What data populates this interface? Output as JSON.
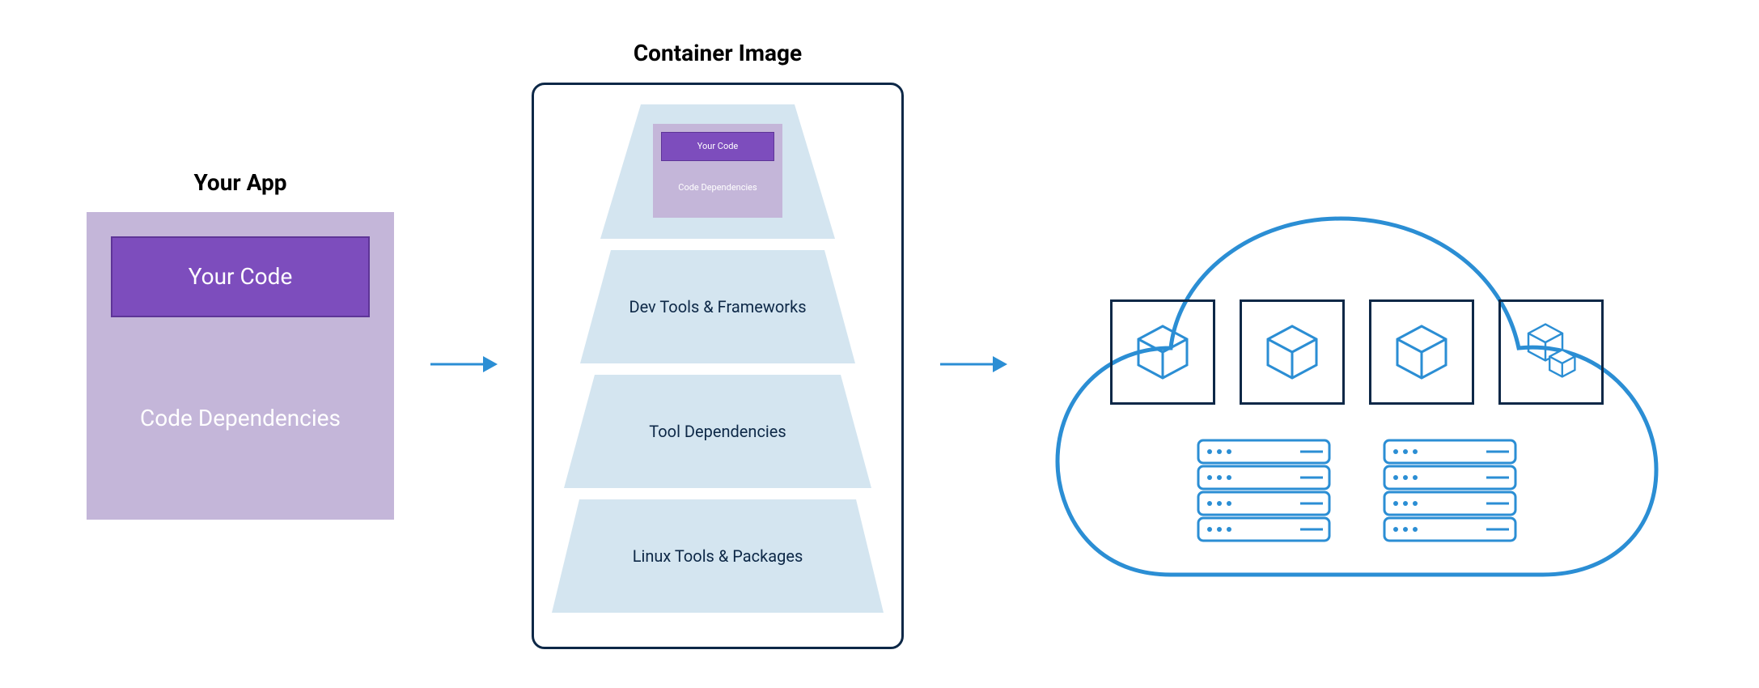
{
  "sections": {
    "app": {
      "title": "Your App",
      "code_label": "Your Code",
      "deps_label": "Code Dependencies"
    },
    "container": {
      "title": "Container Image",
      "mini_code_label": "Your Code",
      "mini_deps_label": "Code Dependencies",
      "layers": [
        "",
        "Dev Tools & Frameworks",
        "Tool Dependencies",
        "Linux Tools & Packages"
      ]
    },
    "cloud": {
      "cube_count": 4,
      "server_count": 2
    }
  },
  "colors": {
    "purple_light": "#c4b6d9",
    "purple_dark": "#7d4dbd",
    "purple_border": "#5e3597",
    "blue_light": "#d4e5f0",
    "blue_accent": "#2b8ed4",
    "navy": "#0d2847"
  }
}
